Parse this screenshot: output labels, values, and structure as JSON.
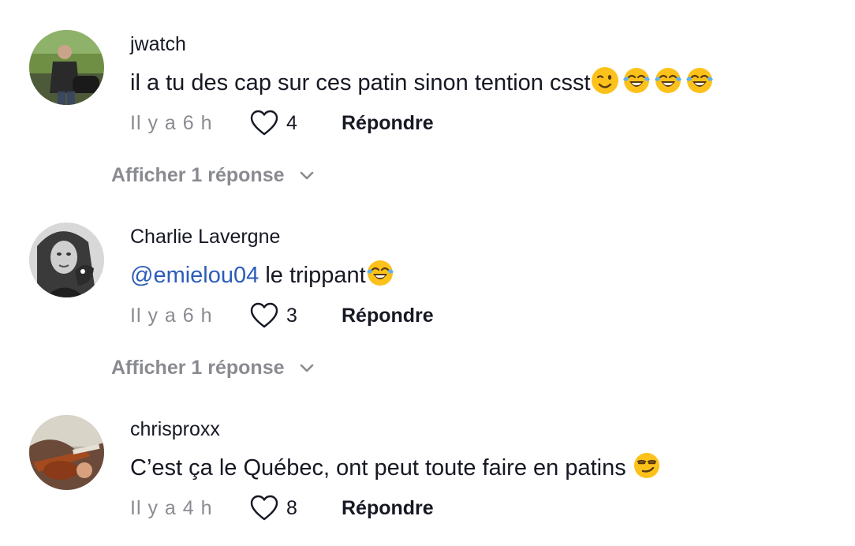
{
  "comments": [
    {
      "username": "jwatch",
      "text": "il a tu des cap sur ces patin sinon tention csst",
      "emojis": [
        "winking-face",
        "tears-of-joy",
        "tears-of-joy",
        "tears-of-joy"
      ],
      "time": "Il y a 6 h",
      "likes": "4",
      "reply_label": "Répondre",
      "show_replies": "Afficher 1 réponse"
    },
    {
      "username": "Charlie Lavergne",
      "mention": "@emielou04",
      "text": " le trippant",
      "emojis": [
        "tears-of-joy"
      ],
      "time": "Il y a 6 h",
      "likes": "3",
      "reply_label": "Répondre",
      "show_replies": "Afficher 1 réponse"
    },
    {
      "username": "chrisproxx",
      "text": "C’est ça le Québec, ont peut toute faire en patins ",
      "emojis": [
        "smirking-face"
      ],
      "time": "Il y a 4 h",
      "likes": "8",
      "reply_label": "Répondre"
    }
  ],
  "colors": {
    "text": "#161823",
    "secondary": "#8a8b91",
    "mention": "#2b5db9"
  },
  "icons": {
    "like": "heart-outline-icon",
    "expand": "chevron-down-icon"
  }
}
